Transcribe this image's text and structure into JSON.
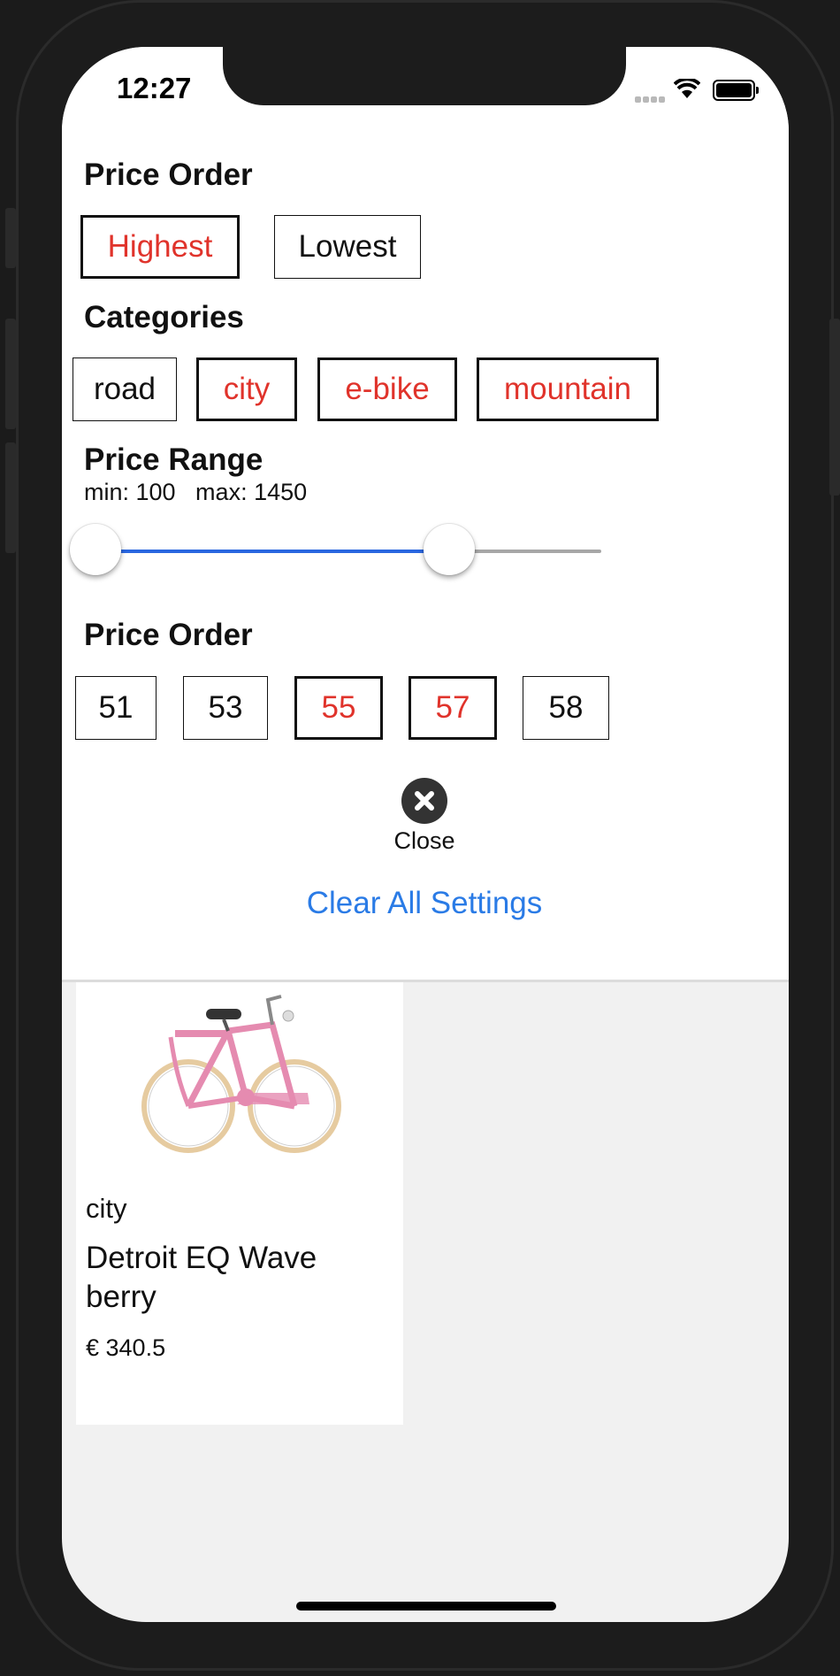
{
  "status": {
    "time": "12:27"
  },
  "filters": {
    "price_order_title": "Price Order",
    "price_order_options": [
      {
        "label": "Highest",
        "selected": true
      },
      {
        "label": "Lowest",
        "selected": false
      }
    ],
    "categories_title": "Categories",
    "categories": [
      {
        "label": "road",
        "selected": false
      },
      {
        "label": "city",
        "selected": true
      },
      {
        "label": "e-bike",
        "selected": true
      },
      {
        "label": "mountain",
        "selected": true
      }
    ],
    "price_range_title": "Price Range",
    "price_range_text": "min: 100   max: 1450",
    "price_range": {
      "min": 100,
      "max": 1450,
      "low_fraction": 0.0,
      "high_fraction": 0.7
    },
    "size_title": "Price Order",
    "sizes": [
      {
        "label": "51",
        "selected": false
      },
      {
        "label": "53",
        "selected": false
      },
      {
        "label": "55",
        "selected": true
      },
      {
        "label": "57",
        "selected": true
      },
      {
        "label": "58",
        "selected": false
      }
    ],
    "close_label": "Close",
    "clear_label": "Clear All Settings"
  },
  "product": {
    "category": "city",
    "name": "Detroit EQ Wave berry",
    "price": "€ 340.5"
  },
  "colors": {
    "selected_text": "#e0332b",
    "link": "#2a7be6",
    "slider_fill": "#2a67e0"
  }
}
